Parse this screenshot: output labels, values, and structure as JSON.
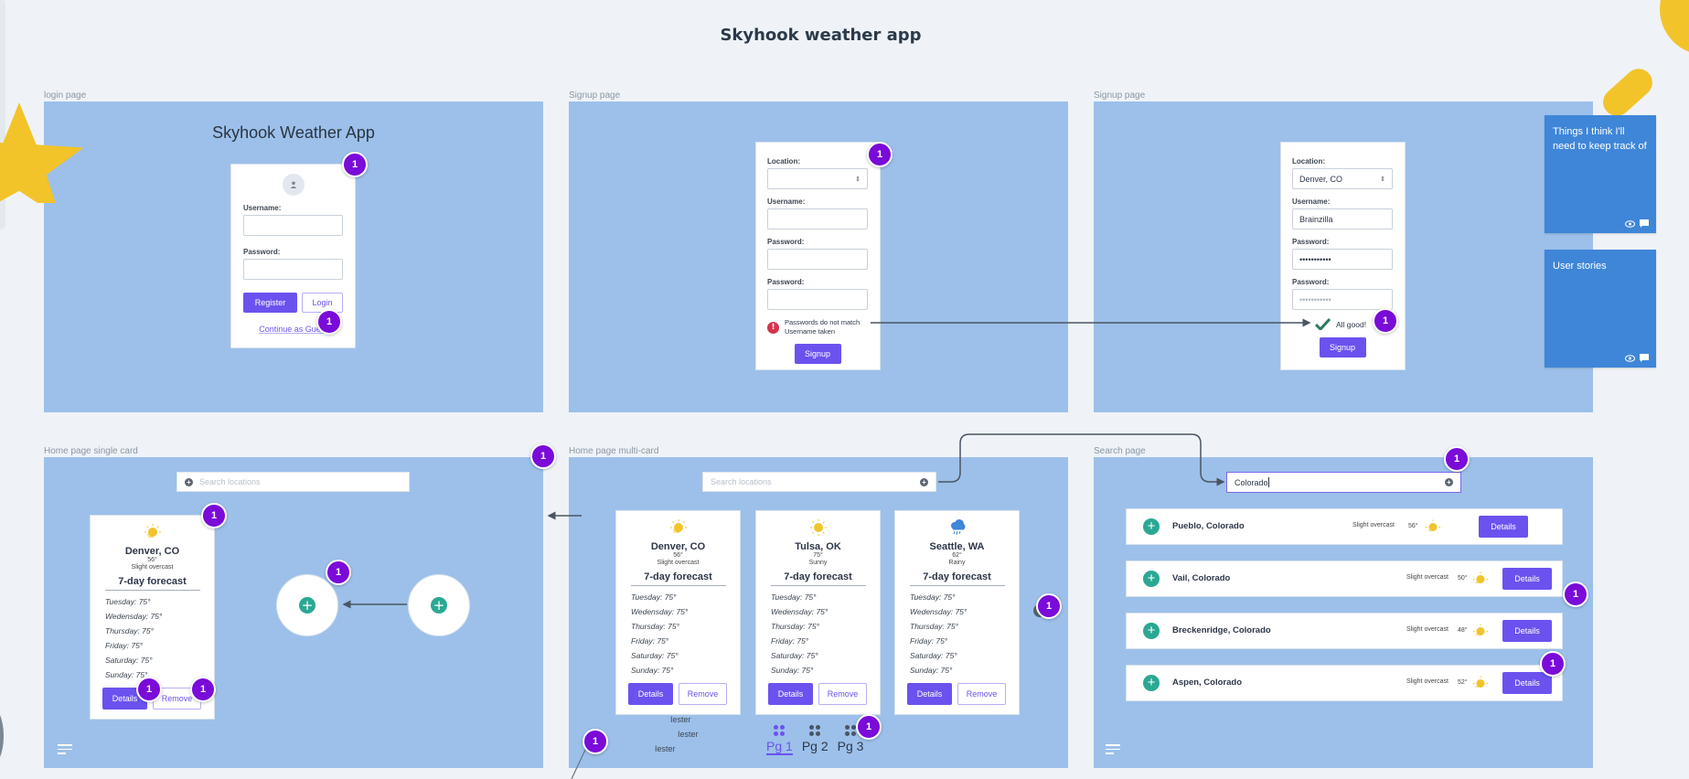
{
  "board": {
    "title": "Skyhook weather app"
  },
  "colors": {
    "frame": "#9cc0ea",
    "primary": "#6b52ef",
    "badge": "#7a0bd8",
    "teal": "#2aa894",
    "sticky": "#3f86d8",
    "sun": "#f3c32a"
  },
  "badge_count": "1",
  "login": {
    "frame_label": "login page",
    "heading": "Skyhook Weather App",
    "username_label": "Username:",
    "password_label": "Password:",
    "register": "Register",
    "login": "Login",
    "guest_link": "Continue as Guest"
  },
  "signup_error": {
    "frame_label": "Signup page",
    "location_label": "Location:",
    "location_value": "",
    "username_label": "Username:",
    "password_label": "Password:",
    "password2_label": "Password:",
    "error_lines": [
      "Passwords do not match",
      "Username taken"
    ],
    "signup": "Signup"
  },
  "signup_ok": {
    "frame_label": "Signup page",
    "location_label": "Location:",
    "location_value": "Denver, CO",
    "username_label": "Username:",
    "username_value": "Brainzilla",
    "password_label": "Password:",
    "password_value": "•••••••••••",
    "password2_label": "Password:",
    "password2_value": "•••••••••••",
    "status": "All good!",
    "signup": "Signup"
  },
  "stickies": [
    {
      "text": "Things I think I'll need to keep track of"
    },
    {
      "text": "User stories"
    }
  ],
  "home_single": {
    "frame_label": "Home page single card",
    "search_placeholder": "Search locations",
    "card": {
      "icon": "partly-sunny-icon",
      "city": "Denver, CO",
      "temp": "56°",
      "cond": "Slight overcast",
      "forecast_title": "7-day forecast",
      "days": [
        "Tuesday: 75°",
        "Wedensday: 75°",
        "Thursday: 75°",
        "Friday: 75°",
        "Saturday: 75°",
        "Sunday: 75°"
      ],
      "details": "Details",
      "remove": "Remove"
    }
  },
  "home_multi": {
    "frame_label": "Home page multi-card",
    "search_placeholder": "Search locations",
    "cards": [
      {
        "icon": "partly-sunny-icon",
        "city": "Denver, CO",
        "temp": "56°",
        "cond": "Slight overcast",
        "forecast_title": "7-day forecast",
        "days": [
          "Tuesday: 75°",
          "Wedensday: 75°",
          "Thursday: 75°",
          "Friday: 75°",
          "Saturday: 75°",
          "Sunday: 75°"
        ],
        "details": "Details",
        "remove": "Remove"
      },
      {
        "icon": "sunny-icon",
        "city": "Tulsa, OK",
        "temp": "75°",
        "cond": "Sunny",
        "forecast_title": "7-day forecast",
        "days": [
          "Tuesday: 75°",
          "Wedensday: 75°",
          "Thursday: 75°",
          "Friday: 75°",
          "Saturday: 75°",
          "Sunday: 75°"
        ],
        "details": "Details",
        "remove": "Remove"
      },
      {
        "icon": "rain-cloud-icon",
        "city": "Seattle, WA",
        "temp": "62°",
        "cond": "Rainy",
        "forecast_title": "7-day forecast",
        "days": [
          "Tuesday: 75°",
          "Wedensday: 75°",
          "Thursday: 75°",
          "Friday: 75°",
          "Saturday: 75°",
          "Sunday: 75°"
        ],
        "details": "Details",
        "remove": "Remove"
      }
    ],
    "testers": [
      "Iester",
      "Iester",
      "Iester"
    ],
    "pages": [
      {
        "label": "Pg 1",
        "active": true
      },
      {
        "label": "Pg 2",
        "active": false
      },
      {
        "label": "Pg 3",
        "active": false
      }
    ]
  },
  "search_page": {
    "frame_label": "Search page",
    "query": "Colorado",
    "results": [
      {
        "name": "Pueblo, Colorado",
        "cond": "Slight overcast",
        "temp": "56°",
        "details": "Details"
      },
      {
        "name": "Vail, Colorado",
        "cond": "Slight overcast",
        "temp": "50°",
        "details": "Details"
      },
      {
        "name": "Breckenridge, Colorado",
        "cond": "Slight overcast",
        "temp": "48°",
        "details": "Details"
      },
      {
        "name": "Aspen, Colorado",
        "cond": "Slight overcast",
        "temp": "52°",
        "details": "Details"
      }
    ]
  }
}
